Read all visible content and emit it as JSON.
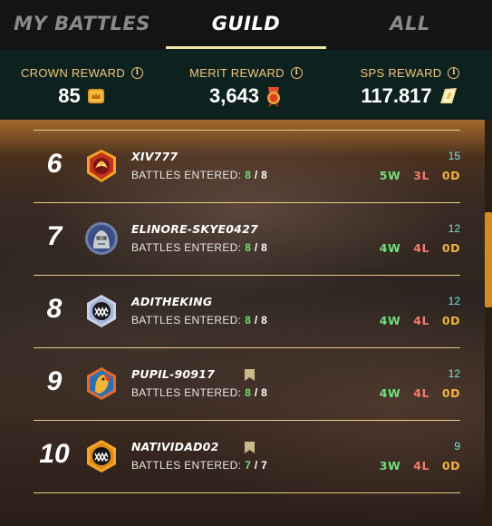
{
  "tabs": [
    {
      "label": "MY BATTLES",
      "active": false
    },
    {
      "label": "GUILD",
      "active": true
    },
    {
      "label": "ALL",
      "active": false
    }
  ],
  "rewards": [
    {
      "label": "CROWN REWARD",
      "value": "85",
      "icon": "crown-token-icon"
    },
    {
      "label": "MERIT REWARD",
      "value": "3,643",
      "icon": "merit-icon"
    },
    {
      "label": "SPS REWARD",
      "value": "117.817",
      "icon": "sps-token-icon"
    }
  ],
  "battles_label": "BATTLES ENTERED:",
  "rows": [
    {
      "rank": "6",
      "name": "XIV777",
      "entered": "8",
      "total": "8",
      "score": "15",
      "w": "5W",
      "l": "3L",
      "d": "0D",
      "avatar": "fire-avatar-icon",
      "bookmark": false
    },
    {
      "rank": "7",
      "name": "ELINORE-SKYE0427",
      "entered": "8",
      "total": "8",
      "score": "12",
      "w": "4W",
      "l": "4L",
      "d": "0D",
      "avatar": "stone-golem-avatar-icon",
      "bookmark": false
    },
    {
      "rank": "8",
      "name": "ADITHEKING",
      "entered": "8",
      "total": "8",
      "score": "12",
      "w": "4W",
      "l": "4L",
      "d": "0D",
      "avatar": "monster-mouth-avatar-icon",
      "bookmark": false
    },
    {
      "rank": "9",
      "name": "PUPIL-90917",
      "entered": "8",
      "total": "8",
      "score": "12",
      "w": "4W",
      "l": "4L",
      "d": "0D",
      "avatar": "parrot-avatar-icon",
      "bookmark": true
    },
    {
      "rank": "10",
      "name": "NATIVIDAD02",
      "entered": "7",
      "total": "7",
      "score": "9",
      "w": "3W",
      "l": "4L",
      "d": "0D",
      "avatar": "gold-monster-avatar-icon",
      "bookmark": true
    }
  ],
  "colors": {
    "accent": "#f3e4a8",
    "win": "#6fe07c",
    "loss": "#ef7b6e",
    "draw": "#f0b23e",
    "score": "#76e0e0"
  }
}
